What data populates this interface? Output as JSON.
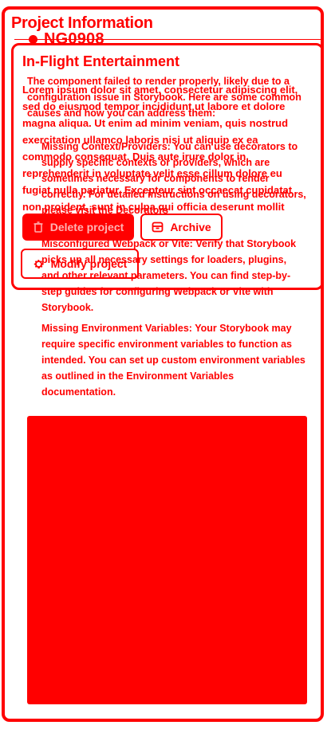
{
  "header": {
    "title": "Project Information",
    "project_code": "NG0908"
  },
  "card": {
    "title": "In-Flight Entertainment",
    "lorem": "Lorem ipsum dolor sit amet, consectetur adipiscing elit, sed do eiusmod tempor incididunt ut labore et dolore magna aliqua. Ut enim ad minim veniam, quis nostrud exercitation ullamco laboris nisi ut aliquip ex ea commodo consequat. Duis aute irure dolor in reprehenderit in voluptate velit esse cillum dolore eu fugiat nulla pariatur. Excepteur sint occaecat cupidatat non proident, sunt in culpa qui officia deserunt mollit anim id est laborum."
  },
  "error": {
    "intro": "The component failed to render properly, likely due to a configuration issue in Storybook. Here are some common causes and how you can address them:",
    "item1_title": "Missing Context/Providers:",
    "item1_body": "You can use decorators to supply specific contexts or providers, which are sometimes necessary for components to render correctly. For detailed instructions on using decorators, please visit the Decorators",
    "item2_title": "Misconfigured Webpack or Vite:",
    "item2_body": "Verify that Storybook picks up all necessary settings for loaders, plugins, and other relevant parameters. You can find step-by-step guides for configuring Webpack or Vite with Storybook.",
    "item3_title": "Missing Environment Variables:",
    "item3_body": "Your Storybook may require specific environment variables to function as intended. You can set up custom environment variables as outlined in the Environment Variables documentation."
  },
  "actions": {
    "delete_label": "Delete project",
    "archive_label": "Archive",
    "modify_label": "Modify project"
  },
  "icons": {
    "delete": "trash-icon",
    "archive": "archive-icon",
    "modify": "gear-icon"
  },
  "colors": {
    "accent": "#ff0000",
    "background": "#ffffff",
    "delete_text": "#ffb3b3"
  }
}
